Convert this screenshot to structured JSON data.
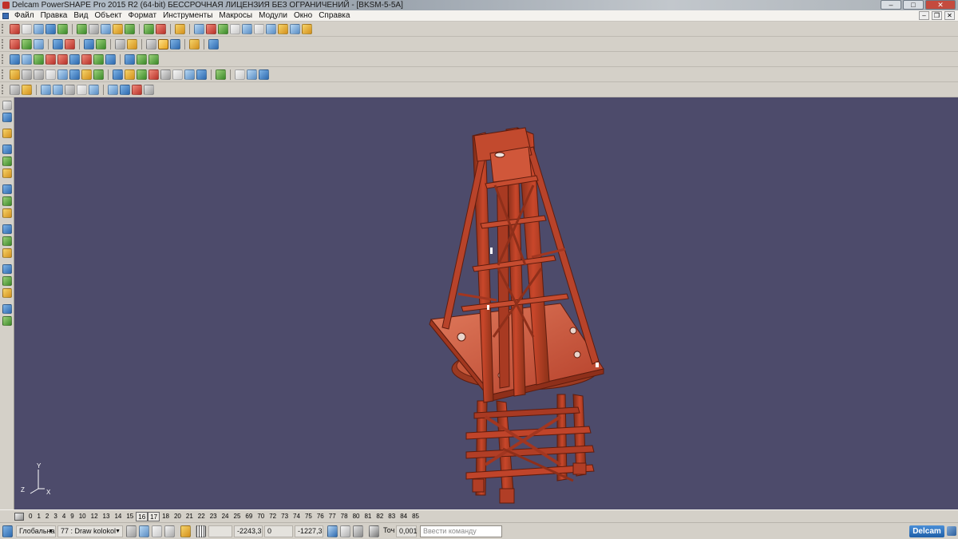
{
  "window": {
    "title": "Delcam PowerSHAPE Pro 2015 R2 (64-bit) БЕССРОЧНАЯ ЛИЦЕНЗИЯ БЕЗ ОГРАНИЧЕНИЙ - [BKSM-5-5A]",
    "minimize": "–",
    "maximize": "□",
    "close": "✕"
  },
  "menu": {
    "items": [
      "Файл",
      "Правка",
      "Вид",
      "Объект",
      "Формат",
      "Инструменты",
      "Макросы",
      "Модули",
      "Окно",
      "Справка"
    ],
    "mdi_minimize": "–",
    "mdi_restore": "❐",
    "mdi_close": "✕"
  },
  "toolbars": {
    "row1": [
      "new",
      "open",
      "open-recent",
      "save",
      "print",
      "sep",
      "cut",
      "copy",
      "paste",
      "paste-special",
      "delete",
      "sep",
      "undo",
      "redo",
      "sep",
      "select-by-type",
      "sep",
      "model-tree",
      "filter",
      "line",
      "circle",
      "spline",
      "text",
      "lamp",
      "shade",
      "wireframe",
      "magic-wand"
    ],
    "row2": [
      "box",
      "cylinder",
      "cone",
      "sep",
      "solid-view",
      "surface-view",
      "sep",
      "zoom-in",
      "zoom-out",
      "sep",
      "zoom-all",
      "zoom-window",
      "sep",
      "globe",
      "shaded",
      "render",
      "sep",
      "light",
      "sep",
      "materials"
    ],
    "row3": [
      "surface",
      "curve",
      "extrude",
      "revolve",
      "sphere",
      "intersect",
      "pipe",
      "duplicate",
      "mirror",
      "sep",
      "grid",
      "stack",
      "wrap"
    ],
    "row4": [
      "view-top",
      "view-front",
      "view-side",
      "view-iso1",
      "view-iso2",
      "view-iso3",
      "view-iso4",
      "view-iso5",
      "sep",
      "disp1",
      "disp2",
      "disp3",
      "disp4",
      "disp5",
      "disp6",
      "disp7",
      "disp8",
      "sep",
      "check",
      "sep",
      "extra1",
      "extra2",
      "extra3"
    ],
    "row5": [
      "cube",
      "xy-axis",
      "sep",
      "cube-shade",
      "box-shade",
      "tool-a",
      "tool-b",
      "tool-c",
      "sep",
      "flow",
      "warp",
      "tool-d",
      "tool-e"
    ]
  },
  "workspace": {
    "axis_labels": {
      "y": "Y",
      "z": "Z",
      "x": "X"
    }
  },
  "levels": {
    "items": [
      "0",
      "1",
      "2",
      "3",
      "4",
      "9",
      "10",
      "12",
      "13",
      "14",
      "15",
      "16",
      "17",
      "18",
      "20",
      "21",
      "22",
      "23",
      "24",
      "25",
      "69",
      "70",
      "72",
      "73",
      "74",
      "75",
      "76",
      "77",
      "78",
      "80",
      "81",
      "82",
      "83",
      "84",
      "85"
    ],
    "active": [
      "16",
      "17"
    ]
  },
  "status": {
    "workplane": "Глобальна",
    "level_value": "77 : Draw kolokol",
    "coord_x": "-2243,3",
    "coord_y": "0",
    "coord_z": "-1227,3",
    "tolerance_label": "Точ",
    "tolerance_value": "0,001",
    "command_placeholder": "Ввести команду",
    "brand": "Delcam"
  }
}
